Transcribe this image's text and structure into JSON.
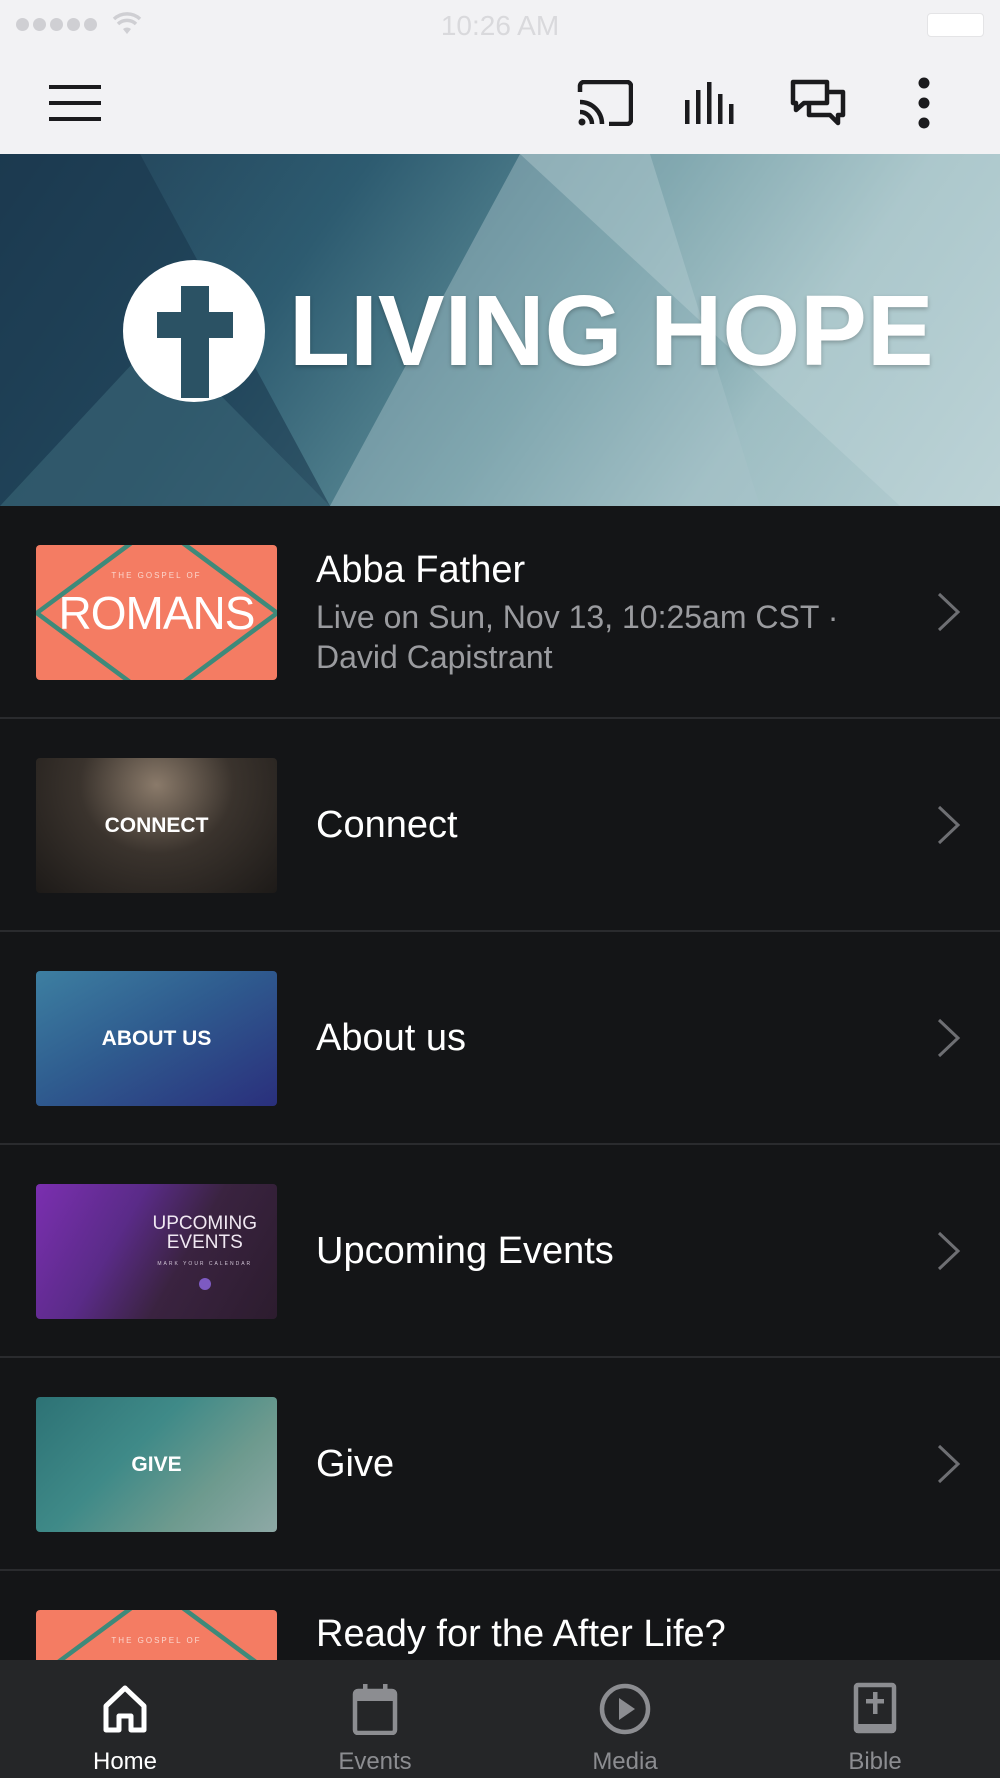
{
  "status_bar": {
    "time": "10:26 AM"
  },
  "app_bar": {
    "menu_icon": "hamburger-menu-icon",
    "actions": [
      "cast-icon",
      "audio-bars-icon",
      "chat-bubbles-icon",
      "more-vertical-icon"
    ]
  },
  "hero": {
    "title": "LIVING HOPE",
    "logo_icon": "cross-circle-icon",
    "colors": {
      "dark": "#213f55",
      "light": "#b7cfd3"
    }
  },
  "list": {
    "items": [
      {
        "title": "Abba Father",
        "subtitle": "Live on Sun, Nov 13, 10:25am CST · David Capistrant",
        "thumb_text": "ROMANS",
        "thumb_small_text": "THE GOSPEL OF"
      },
      {
        "title": "Connect",
        "thumb_text": "CONNECT"
      },
      {
        "title": "About us",
        "thumb_text": "ABOUT US"
      },
      {
        "title": "Upcoming Events",
        "thumb_text_line1": "UPCOMING",
        "thumb_text_line2": "EVENTS",
        "thumb_small_text": "MARK YOUR CALENDAR"
      },
      {
        "title": "Give",
        "thumb_text": "GIVE"
      },
      {
        "title": "Ready for the After Life?",
        "thumb_small_text": "THE GOSPEL OF"
      }
    ]
  },
  "tabs": [
    {
      "label": "Home",
      "icon": "home-icon",
      "active": true
    },
    {
      "label": "Events",
      "icon": "calendar-icon",
      "active": false
    },
    {
      "label": "Media",
      "icon": "play-circle-icon",
      "active": false
    },
    {
      "label": "Bible",
      "icon": "bible-icon",
      "active": false
    }
  ],
  "theme": {
    "background": "#141517",
    "divider": "#2a2b2e",
    "tab_bar": "#252628",
    "romans_accent": "#f47c63"
  }
}
